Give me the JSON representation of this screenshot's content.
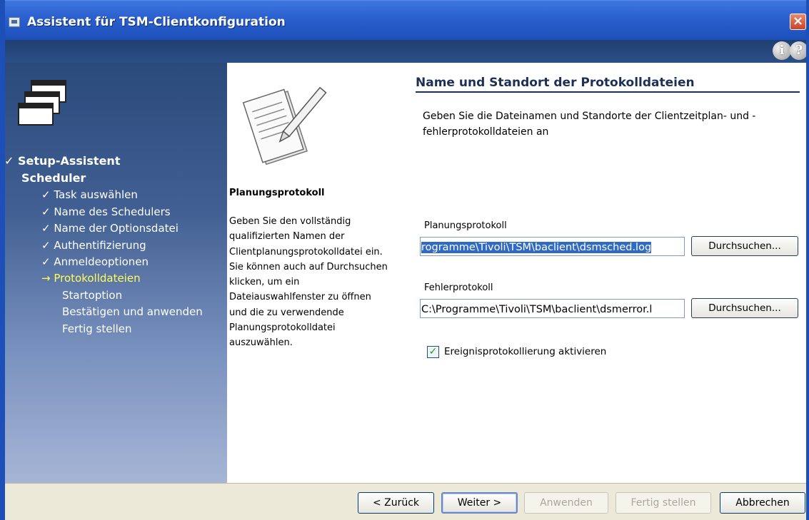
{
  "window": {
    "title": "Assistent für TSM-Clientkonfiguration",
    "close_label": "×",
    "info_label": "i",
    "help_label": "?"
  },
  "nav": {
    "items": [
      {
        "label": "✓ Setup-Assistent",
        "level": "main",
        "state": "done"
      },
      {
        "label": "Scheduler",
        "level": "main",
        "state": "group"
      },
      {
        "label": "✓ Task auswählen",
        "level": "sub",
        "state": "done"
      },
      {
        "label": "✓ Name des Schedulers",
        "level": "sub",
        "state": "done"
      },
      {
        "label": "✓ Name der Optionsdatei",
        "level": "sub",
        "state": "done"
      },
      {
        "label": "✓ Authentifizierung",
        "level": "sub",
        "state": "done"
      },
      {
        "label": "✓ Anmeldeoptionen",
        "level": "sub",
        "state": "done"
      },
      {
        "label": "→ Protokolldateien",
        "level": "sub",
        "state": "current"
      },
      {
        "label": "Startoption",
        "level": "sub",
        "state": "pending"
      },
      {
        "label": "Bestätigen und anwenden",
        "level": "sub",
        "state": "pending"
      },
      {
        "label": "Fertig stellen",
        "level": "sub",
        "state": "pending"
      }
    ]
  },
  "mid": {
    "title": "Planungsprotokoll",
    "description": "Geben Sie den vollständig qualifizierten Namen der Clientplanungsprotokolldatei ein. Sie können auch auf Durchsuchen klicken, um ein Dateiauswahlfenster zu öffnen und die zu verwendende Planungsprotokolldatei auszuwählen."
  },
  "content": {
    "title": "Name und Standort der Protokolldateien",
    "subtitle": "Geben Sie die Dateinamen und Standorte der Clientzeitplan- und -fehlerprotokolldateien an",
    "schedule_log": {
      "label": "Planungsprotokoll",
      "value": "rogramme\\Tivoli\\TSM\\baclient\\dsmsched.log",
      "browse_label": "Durchsuchen..."
    },
    "error_log": {
      "label": "Fehlerprotokoll",
      "value": "C:\\Programme\\Tivoli\\TSM\\baclient\\dsmerror.l",
      "browse_label": "Durchsuchen..."
    },
    "event_logging": {
      "label": "Ereignisprotokollierung aktivieren",
      "checked": true
    }
  },
  "buttons": {
    "back": "< Zurück",
    "next": "Weiter >",
    "apply": "Anwenden",
    "finish": "Fertig stellen",
    "cancel": "Abbrechen"
  }
}
